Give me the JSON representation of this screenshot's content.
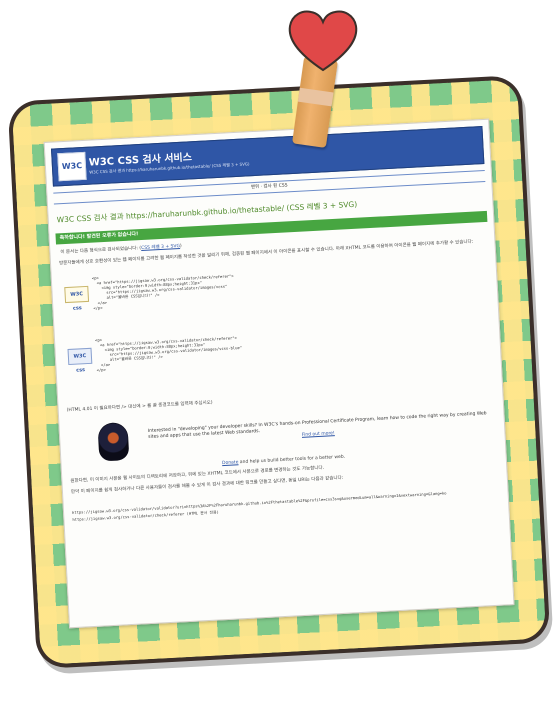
{
  "header": {
    "logo": "W3C",
    "title": "W3C CSS 검사 서비스",
    "subtitle": "W3C CSS 검사 결과 https://haruharunbk.github.io/thetastable/ (CSS 레벨 3 + SVG)"
  },
  "nav": {
    "label": "맨위 · 검사 된 CSS"
  },
  "result": {
    "title": "W3C CSS 검사 결과 https://haruharunbk.github.io/thetastable/ (CSS 레벨 3 + SVG)",
    "ok_bar": "축하합니다! 발견된 오류가 없습니다!",
    "ok_line_prefix": "이 문서는 다음 형식으로 검사되었습니다:",
    "ok_line_link": "CSS 레벨 3 + SVG",
    "para": "방문자들에게 상호 호환성이 있는 웹 페이지를 고려한 웹 페이지를 작성한 것을 알리기 위해, 검증된 웹 페이지에서 이 아이콘을 표시할 수 있습니다. 아래 XHTML 코드를 이용하여 아이콘을 웹 페이지에 추가할 수 있습니다:"
  },
  "badges": [
    {
      "label": "W3C css",
      "code": "<p>\n  <a href=\"https://jigsaw.w3.org/css-validator/check/referer\">\n    <img style=\"border:0;width:88px;height:31px\"\n      src=\"https://jigsaw.w3.org/css-validator/images/vcss\"\n      alt=\"올바른 CSS입니다!\" />\n  </a>\n</p>"
    },
    {
      "label": "W3C css",
      "code": "<p>\n  <a href=\"https://jigsaw.w3.org/css-validator/check/referer\">\n    <img style=\"border:0;width:88px;height:31px\"\n      src=\"https://jigsaw.w3.org/css-validator/images/vcss-blue\"\n      alt=\"올바른 CSS입니다!\" />\n  </a>\n</p>"
    }
  ],
  "footnote": "(HTML 4.01 이 필요하다면 /> 대신에 > 를 끝 종결코드를 입력해 주십시오)",
  "promo": {
    "text": "Interested in \"developing\" your developer skills? In W3C's hands-on Professional Certificate Program, learn how to code the right way by creating Web sites and apps that use the latest Web standards.",
    "more": "Find out more!"
  },
  "donate": {
    "link": "Donate",
    "text": " and help us build better tools for a better web."
  },
  "tail": [
    "원한다면, 이 이미지 사본을 웹 사이트의 디렉토리에 저장하고, 위에 있는 XHTML 코드에서 사본으로 경로를 변경하는 것도 가능합니다.",
    "만약 이 페이지를 쉽게 검사하거나 다른 사용자들이 검사를 해볼 수 있게 이 검사 결과에 대한 링크를 만들고 싶다면, 동일 URI는 다음과 같습니다:"
  ],
  "tail_code": [
    "https://jigsaw.w3.org/css-validator/validator?uri=https%3A%2F%2Fharuharunbk.github.io%2Fthetastable%2F&profile=css3svg&usermedium=all&warning=1&vextwarning=&lang=ko",
    "https://jigsaw.w3.org/css-validator/check/referer (HTML 문서 전용)"
  ]
}
